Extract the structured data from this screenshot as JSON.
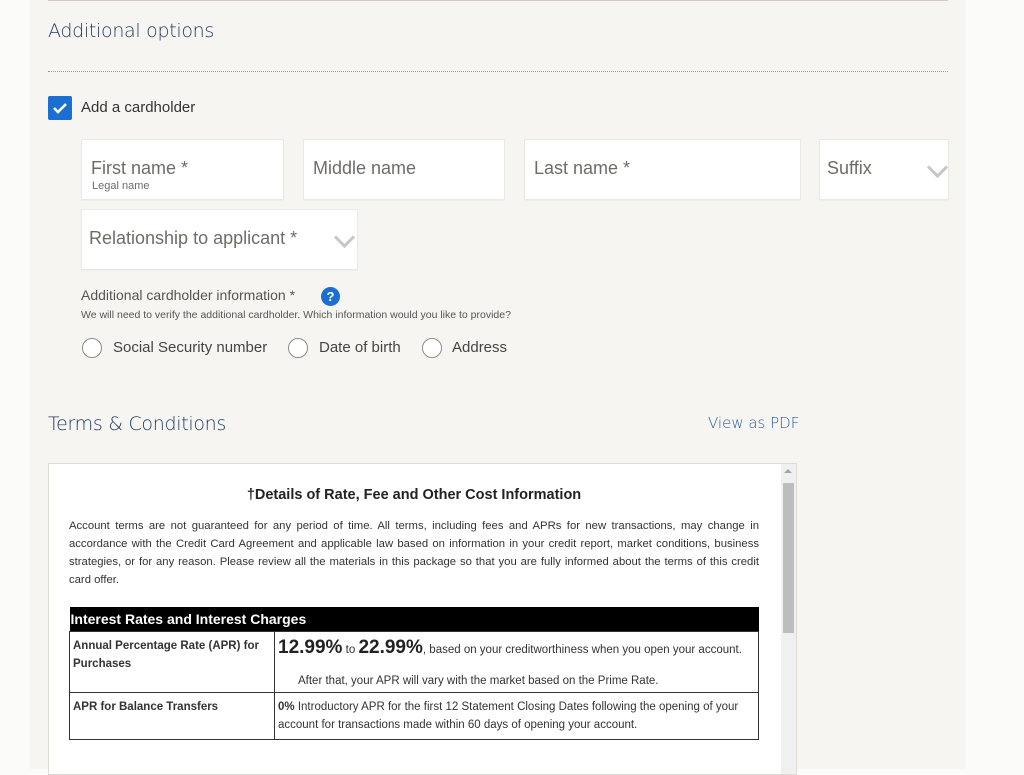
{
  "additional_options": {
    "title": "Additional options",
    "add_cardholder": {
      "label": "Add a cardholder",
      "checked": true
    },
    "fields": {
      "first_name": {
        "placeholder": "First name *",
        "hint": "Legal name"
      },
      "middle_name": {
        "placeholder": "Middle name"
      },
      "last_name": {
        "placeholder": "Last name *"
      },
      "suffix": {
        "placeholder": "Suffix"
      },
      "relationship": {
        "placeholder": "Relationship to applicant *"
      }
    },
    "cardholder_info": {
      "label": "Additional cardholder information *",
      "help_icon": "?",
      "description": "We will need to verify the additional cardholder. Which information would you like to provide?",
      "options": [
        "Social Security number",
        "Date of birth",
        "Address"
      ]
    }
  },
  "terms": {
    "title": "Terms & Conditions",
    "pdf_link": "View as PDF",
    "doc_title": "†Details of Rate, Fee and Other Cost Information",
    "intro": "Account terms are not guaranteed for any period of time. All terms, including fees and APRs for new transactions, may change in accordance with the Credit Card Agreement and applicable law based on information in your credit report, market conditions, business strategies, or for any reason. Please review all the materials in this package so that you are fully informed about the terms of this credit card offer.",
    "table": {
      "header": "Interest Rates and Interest Charges",
      "rows": [
        {
          "label": "Annual Percentage Rate (APR) for Purchases",
          "rate_low": "12.99%",
          "to": "to",
          "rate_high": "22.99%",
          "text": ", based on your creditworthiness when you open your account.",
          "note": "After that, your APR will vary with the market based on the Prime Rate."
        },
        {
          "label": "APR for Balance Transfers",
          "rate": "0%",
          "text": "Introductory APR for the first 12 Statement Closing Dates following the opening of your account for transactions made within 60 days of opening your account."
        }
      ]
    }
  }
}
